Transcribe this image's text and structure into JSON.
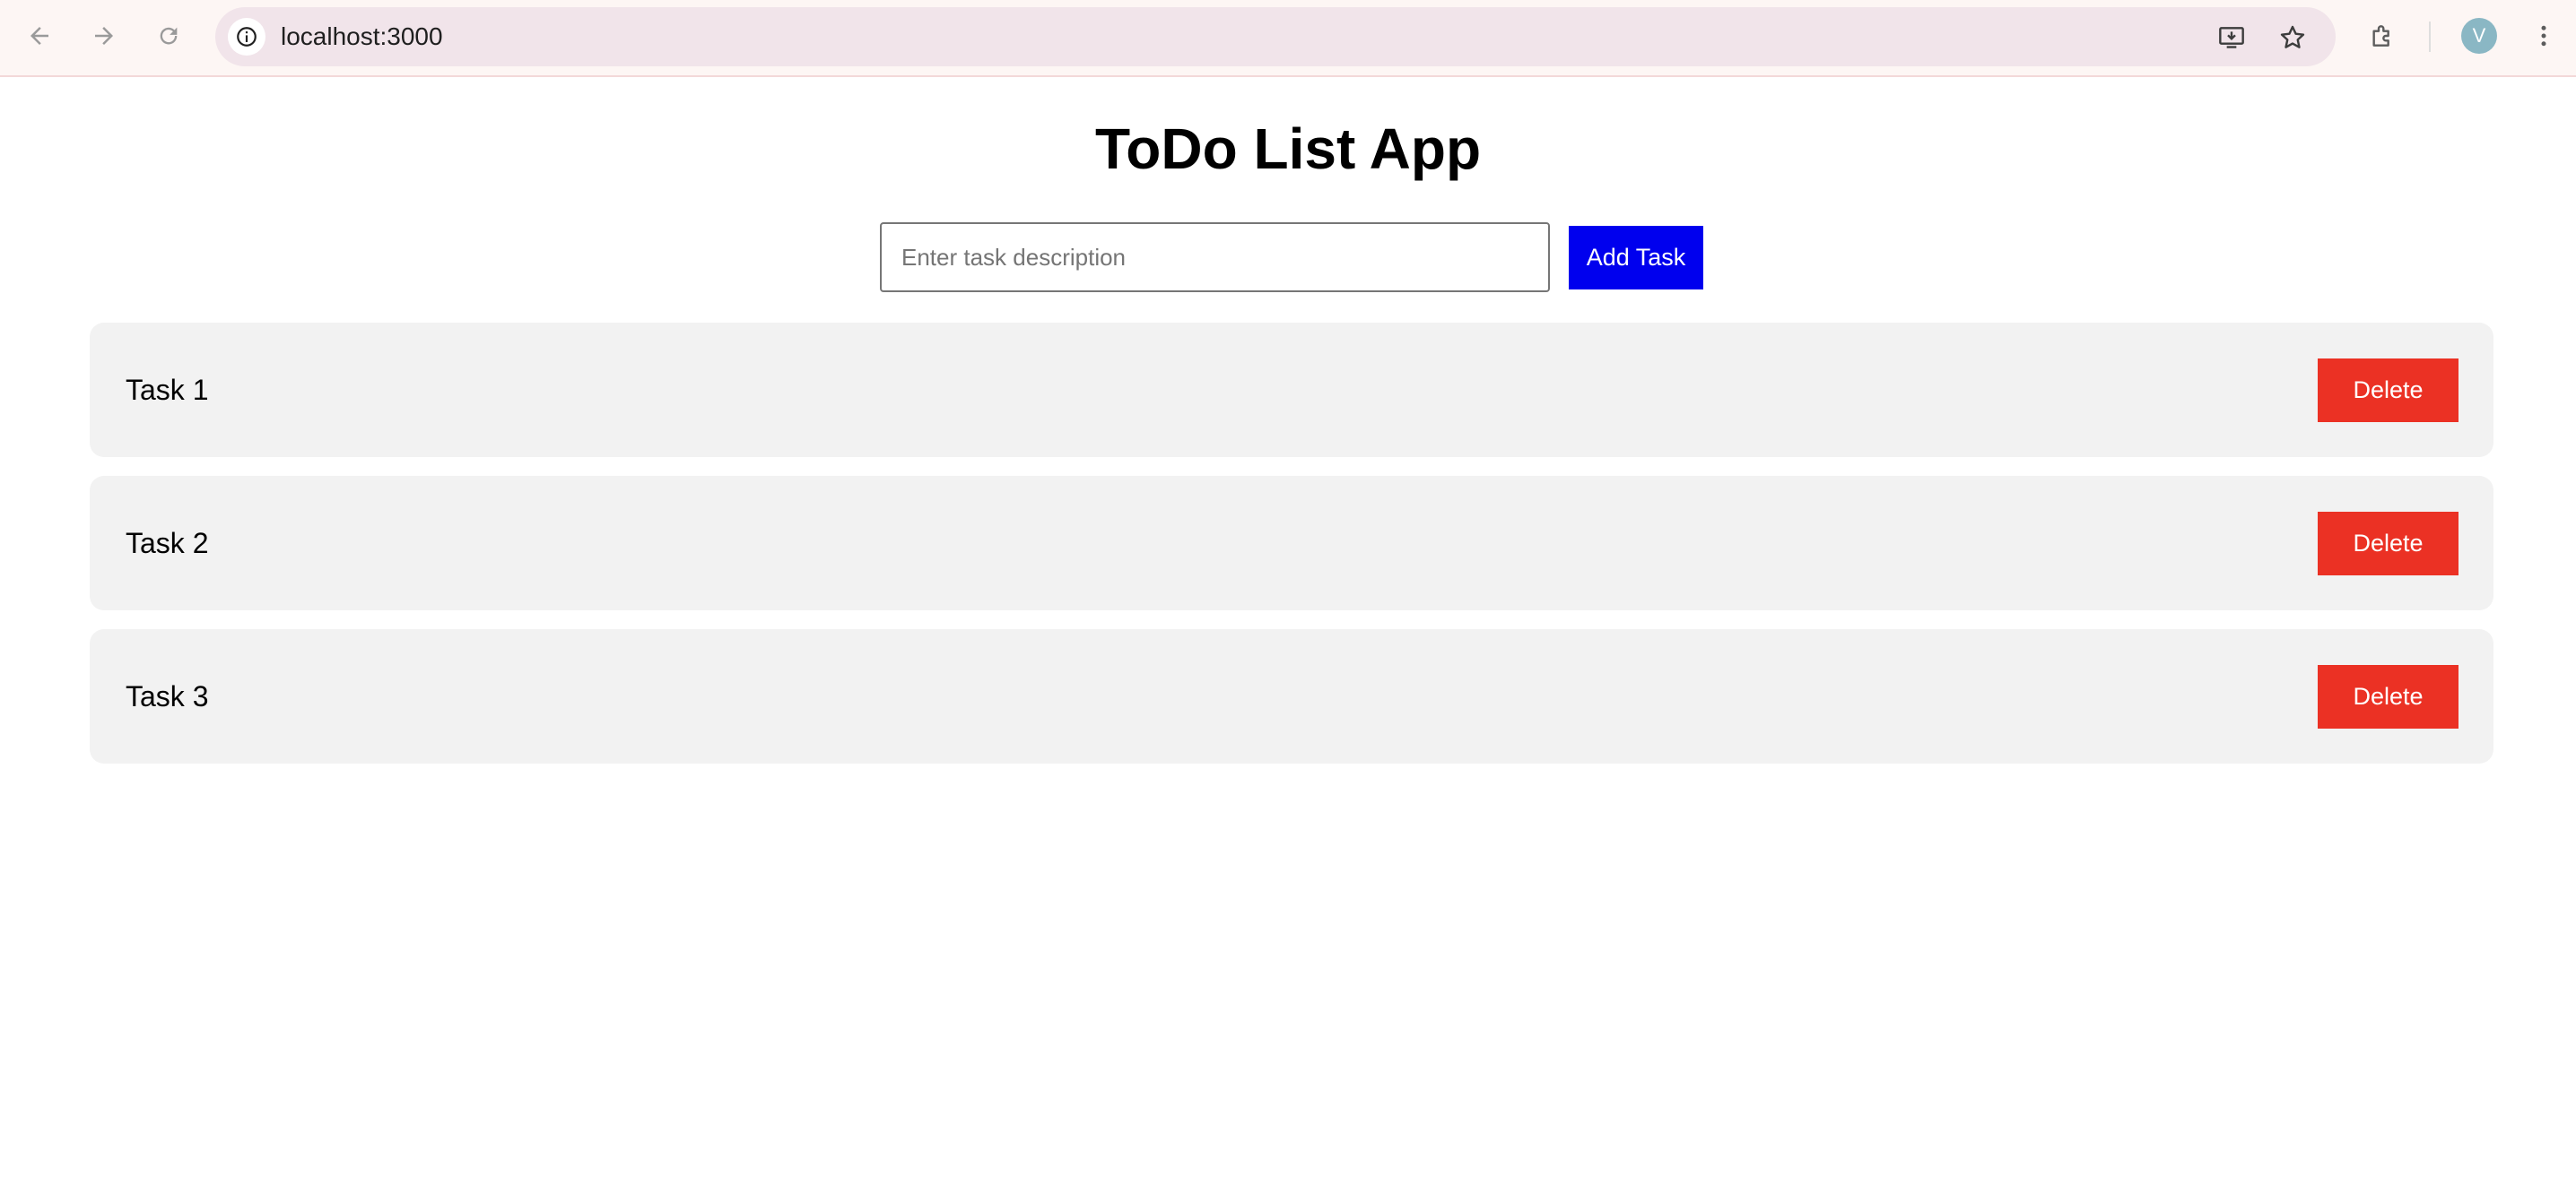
{
  "browser": {
    "url": "localhost:3000",
    "profile_initial": "V"
  },
  "app": {
    "title": "ToDo List App",
    "input_placeholder": "Enter task description",
    "add_button_label": "Add Task",
    "add_button_color": "#0000ee",
    "delete_button_color": "#eb3124"
  },
  "tasks": [
    {
      "label": "Task 1",
      "delete_label": "Delete"
    },
    {
      "label": "Task 2",
      "delete_label": "Delete"
    },
    {
      "label": "Task 3",
      "delete_label": "Delete"
    }
  ]
}
